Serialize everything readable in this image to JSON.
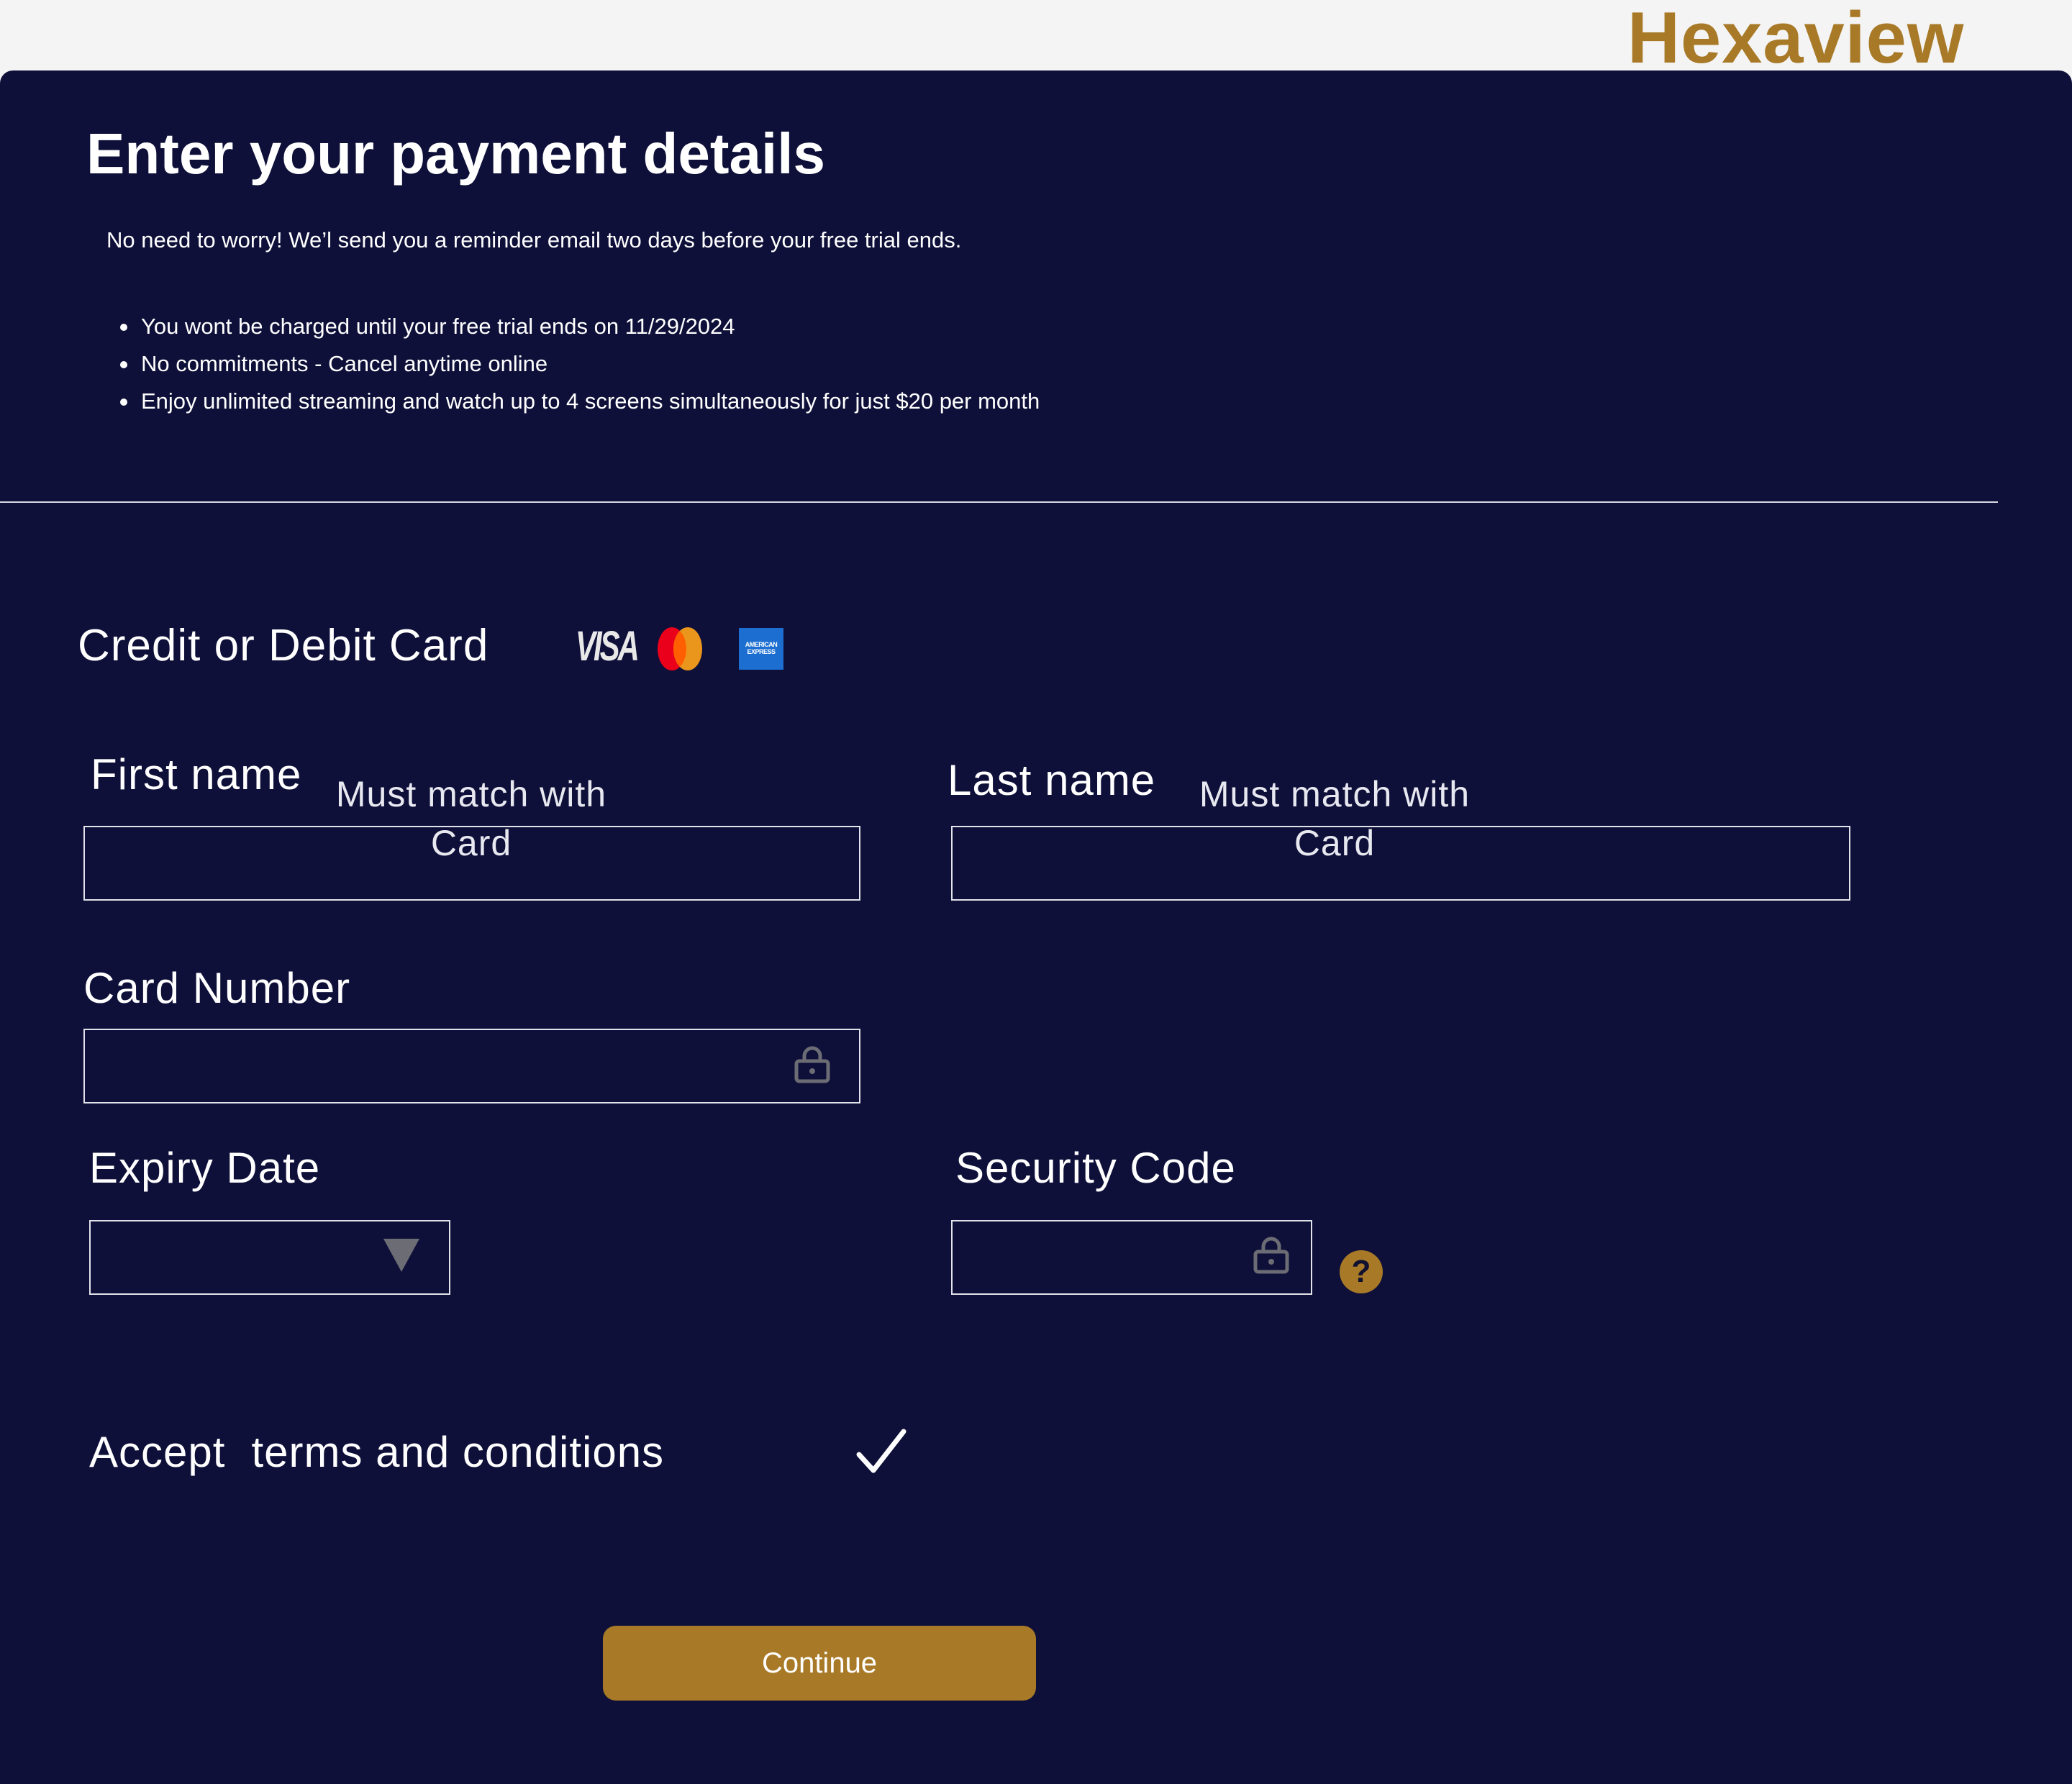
{
  "brand": {
    "name": "Hexaview"
  },
  "page": {
    "title": "Enter your payment details",
    "subtitle": "No need to worry! We’l send you a reminder email two days before your free trial ends.",
    "bullets": [
      "You wont be charged until your free trial ends on 11/29/2024",
      "No commitments - Cancel anytime online",
      "Enjoy unlimited streaming and watch up to 4 screens simultaneously for just $20 per month"
    ]
  },
  "payment": {
    "section_label": "Credit or Debit Card",
    "card_logos": {
      "visa": "VISA",
      "amex_line1": "AMERICAN",
      "amex_line2": "EXPRESS"
    },
    "first_name": {
      "label": "First name",
      "hint_line1": "Must match with",
      "hint_line2": "Card"
    },
    "last_name": {
      "label": "Last name",
      "hint_line1": "Must match with",
      "hint_line2": "Card"
    },
    "card_number": {
      "label": "Card Number"
    },
    "expiry": {
      "label": "Expiry Date"
    },
    "security_code": {
      "label": "Security Code",
      "help": "?"
    },
    "terms": {
      "accept": "Accept",
      "text": "terms and conditions"
    },
    "continue_label": "Continue"
  },
  "icons": {
    "lock": "lock-icon",
    "dropdown": "triangle-down-icon",
    "help": "question-circle-icon",
    "check": "checkmark-icon"
  },
  "colors": {
    "background": "#f4f4f4",
    "panel": "#0e1039",
    "accent": "#a87a28",
    "text": "#ffffff"
  }
}
